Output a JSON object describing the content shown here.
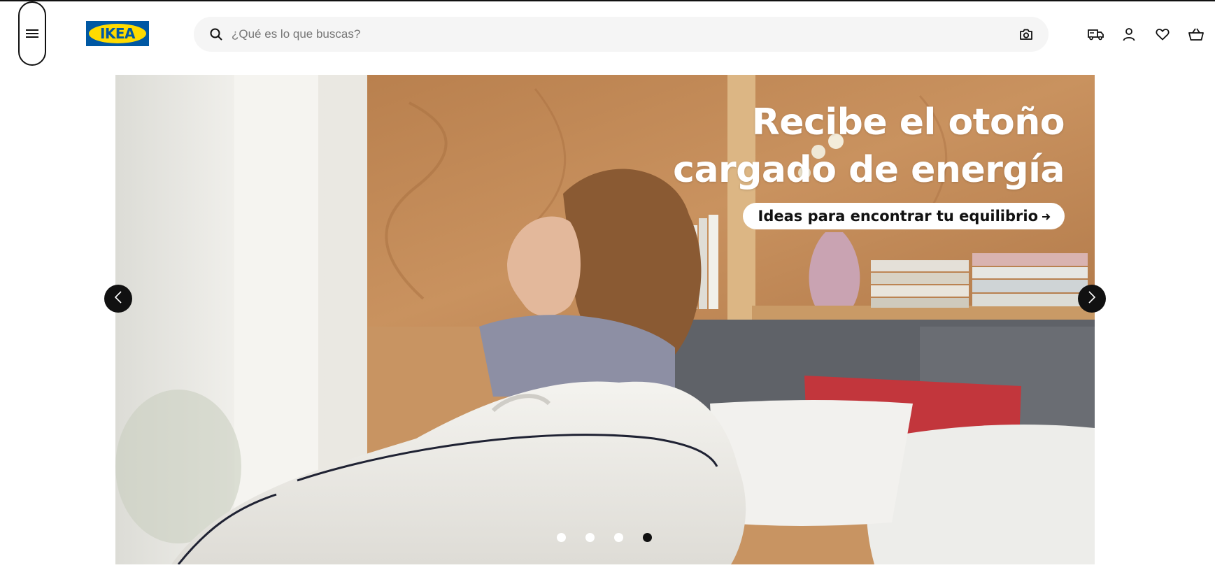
{
  "header": {
    "logo_text": "IKEA",
    "search": {
      "placeholder": "¿Qué es lo que buscas?",
      "value": ""
    },
    "icons": [
      "menu-icon",
      "search-icon",
      "camera-icon",
      "delivery-truck-icon",
      "user-icon",
      "heart-icon",
      "shopping-basket-icon"
    ]
  },
  "hero": {
    "headline_line1": "Recibe el otoño",
    "headline_line2": "cargado de energía",
    "cta_label": "Ideas para encontrar tu equilibrio",
    "slides_total": 4,
    "active_slide": 4
  },
  "colors": {
    "ikea_blue": "#0058a3",
    "ikea_yellow": "#ffdb00",
    "text": "#111111",
    "search_bg": "#f5f5f5"
  }
}
